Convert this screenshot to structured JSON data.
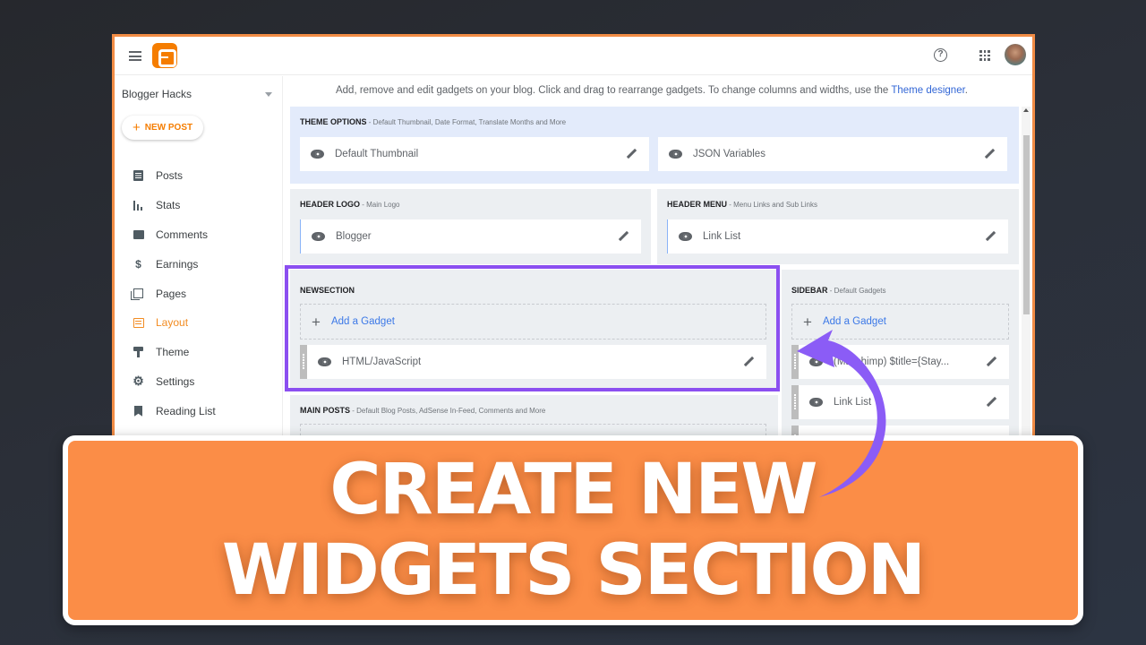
{
  "app": {
    "name": "Blogger",
    "brand_color": "#f57d00",
    "frame_color": "#f28c45",
    "highlight_color": "#8b4ff0"
  },
  "topbar": {
    "menu_icon": "hamburger-icon",
    "logo_icon": "blogger-logo-icon",
    "help_icon": "help-circle-icon",
    "help_glyph": "?",
    "apps_icon": "apps-grid-icon",
    "avatar_icon": "user-avatar"
  },
  "sidebar": {
    "blog_name": "Blogger Hacks",
    "new_post_label": "NEW POST",
    "items": [
      {
        "label": "Posts",
        "icon": "posts-icon",
        "active": false
      },
      {
        "label": "Stats",
        "icon": "stats-icon",
        "active": false
      },
      {
        "label": "Comments",
        "icon": "comments-icon",
        "active": false
      },
      {
        "label": "Earnings",
        "icon": "dollar-icon",
        "glyph": "$",
        "active": false
      },
      {
        "label": "Pages",
        "icon": "pages-icon",
        "active": false
      },
      {
        "label": "Layout",
        "icon": "layout-icon",
        "active": true
      },
      {
        "label": "Theme",
        "icon": "paint-roller-icon",
        "active": false
      },
      {
        "label": "Settings",
        "icon": "gear-icon",
        "glyph": "⚙",
        "active": false
      },
      {
        "label": "Reading List",
        "icon": "bookmark-icon",
        "active": false
      }
    ]
  },
  "main": {
    "intro_text": "Add, remove and edit gadgets on your blog. Click and drag to rearrange gadgets. To change columns and widths, use the ",
    "intro_link": "Theme designer",
    "intro_end": ".",
    "add_gadget_label": "Add a Gadget",
    "sections": {
      "theme_options": {
        "title": "THEME OPTIONS",
        "subtitle": " - Default Thumbnail, Date Format, Translate Months and More",
        "gadgets": [
          "Default Thumbnail",
          "JSON Variables"
        ]
      },
      "header_logo": {
        "title": "HEADER LOGO",
        "subtitle": " - Main Logo",
        "gadgets": [
          "Blogger"
        ]
      },
      "header_menu": {
        "title": "HEADER MENU",
        "subtitle": " - Menu Links and Sub Links",
        "gadgets": [
          "Link List"
        ]
      },
      "newsection": {
        "title": "NEWSECTION",
        "subtitle": "",
        "gadgets": [
          "HTML/JavaScript"
        ]
      },
      "sidebar": {
        "title": "SIDEBAR",
        "subtitle": " - Default Gadgets",
        "gadgets": [
          "(Mailchimp) $title={Stay...",
          "Link List"
        ]
      },
      "main_posts": {
        "title": "MAIN POSTS",
        "subtitle": " - Default Blog Posts, AdSense In-Feed, Comments and More"
      }
    }
  },
  "banner": {
    "line1": "CREATE NEW",
    "line2": "WIDGETS SECTION",
    "bg_color": "#fb8d47"
  }
}
